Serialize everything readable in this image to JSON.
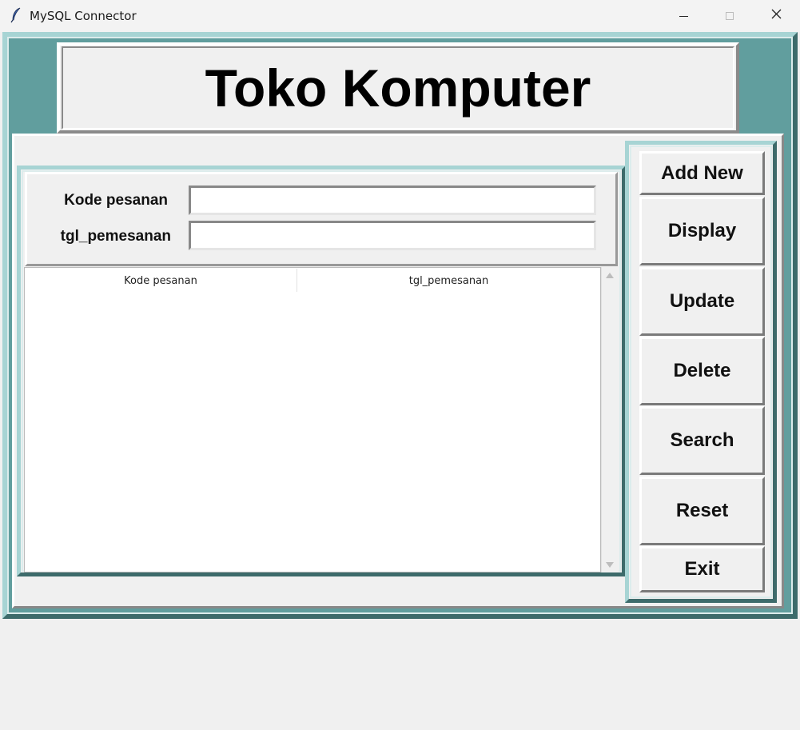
{
  "window": {
    "title": "MySQL Connector",
    "icon": "feather-icon",
    "controls": [
      "minimize-icon",
      "maximize-icon",
      "close-icon"
    ]
  },
  "header": {
    "title": "Toko Komputer"
  },
  "form": {
    "fields": [
      {
        "label": "Kode pesanan",
        "value": ""
      },
      {
        "label": "tgl_pemesanan",
        "value": ""
      }
    ]
  },
  "table": {
    "columns": [
      "Kode pesanan",
      "tgl_pemesanan"
    ],
    "rows": []
  },
  "buttons": {
    "add_new": "Add New",
    "display": "Display",
    "update": "Update",
    "delete": "Delete",
    "search": "Search",
    "reset": "Reset",
    "exit": "Exit"
  },
  "colors": {
    "frame_teal": "#619e9e",
    "frame_dark": "#3d6b6b",
    "frame_light": "#a7d4d4",
    "panel_bg": "#f0f0f0"
  }
}
